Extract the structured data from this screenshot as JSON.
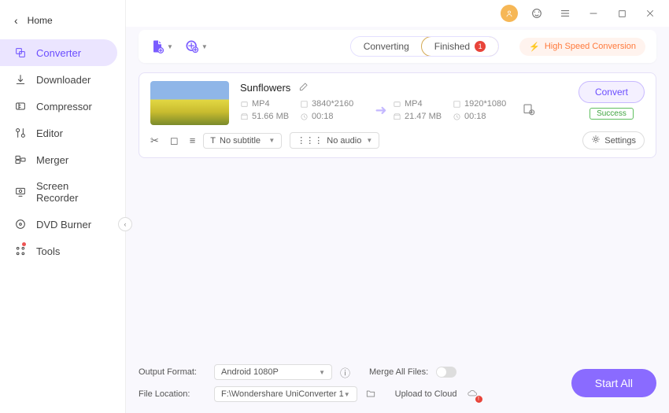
{
  "sidebar": {
    "home": "Home",
    "items": [
      {
        "label": "Converter"
      },
      {
        "label": "Downloader"
      },
      {
        "label": "Compressor"
      },
      {
        "label": "Editor"
      },
      {
        "label": "Merger"
      },
      {
        "label": "Screen Recorder"
      },
      {
        "label": "DVD Burner"
      },
      {
        "label": "Tools"
      }
    ]
  },
  "toolbar": {
    "tabs": {
      "converting": "Converting",
      "finished": "Finished",
      "finished_count": "1"
    },
    "hispeed": "High Speed Conversion"
  },
  "card": {
    "title": "Sunflowers",
    "src": {
      "format": "MP4",
      "res": "3840*2160",
      "size": "51.66 MB",
      "dur": "00:18"
    },
    "dst": {
      "format": "MP4",
      "res": "1920*1080",
      "size": "21.47 MB",
      "dur": "00:18"
    },
    "subtitle": "No subtitle",
    "audio": "No audio",
    "settings": "Settings",
    "convert": "Convert",
    "status": "Success"
  },
  "bottom": {
    "output_label": "Output Format:",
    "output_value": "Android 1080P",
    "location_label": "File Location:",
    "location_value": "F:\\Wondershare UniConverter 1",
    "merge_label": "Merge All Files:",
    "cloud_label": "Upload to Cloud",
    "start": "Start All"
  }
}
